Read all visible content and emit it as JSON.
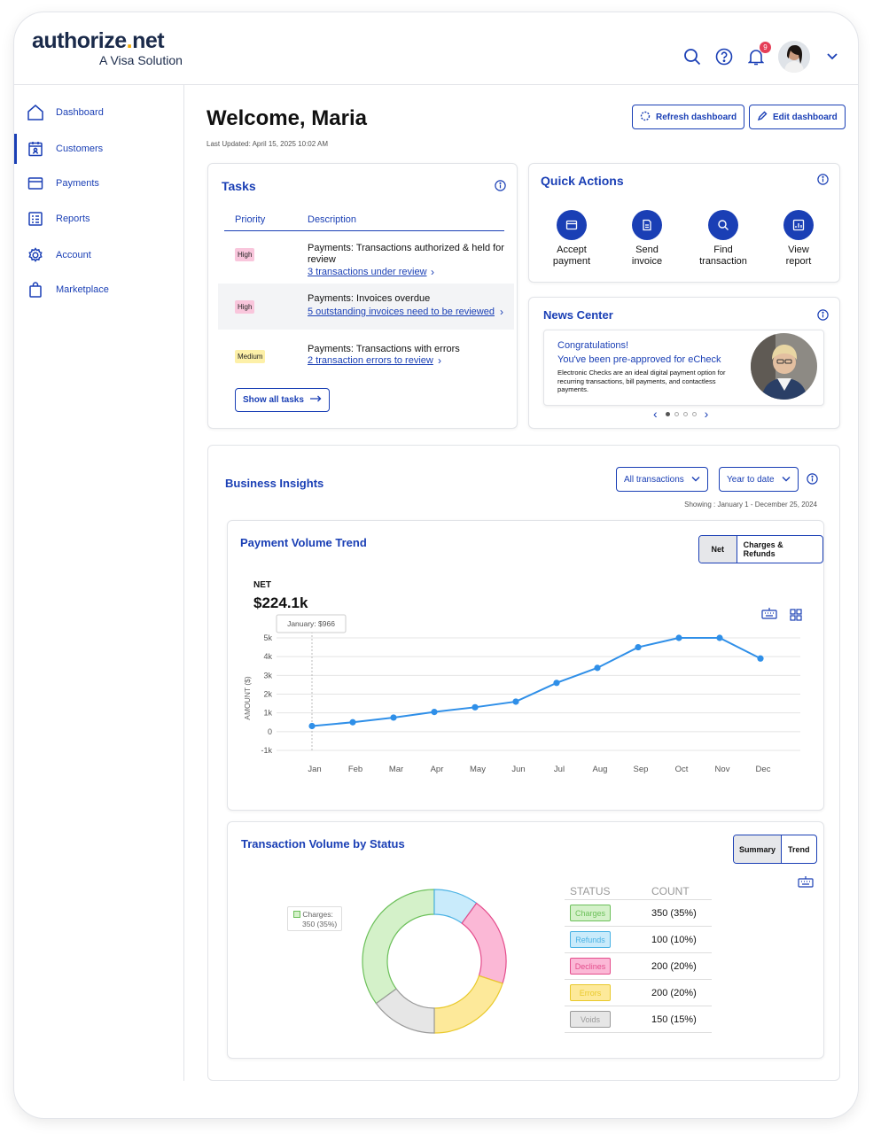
{
  "brand": {
    "name_part1": "authorize",
    "name_dot": ".",
    "name_part2": "net",
    "tagline": "A Visa Solution"
  },
  "header": {
    "notification_count": "9"
  },
  "sidebar": {
    "items": [
      {
        "label": "Dashboard",
        "icon": "home-icon"
      },
      {
        "label": "Customers",
        "icon": "calendar-user-icon",
        "active": true
      },
      {
        "label": "Payments",
        "icon": "card-icon"
      },
      {
        "label": "Reports",
        "icon": "report-icon"
      },
      {
        "label": "Account",
        "icon": "gear-icon"
      },
      {
        "label": "Marketplace",
        "icon": "bag-icon"
      }
    ]
  },
  "page": {
    "title": "Welcome, Maria",
    "last_updated": "Last Updated: April 15, 2025 10:02 AM",
    "refresh_label": "Refresh dashboard",
    "edit_label": "Edit dashboard"
  },
  "tasks": {
    "title": "Tasks",
    "col_priority": "Priority",
    "col_description": "Description",
    "rows": [
      {
        "priority": "High",
        "title": "Payments: Transactions authorized & held for review",
        "link": "3 transactions under review"
      },
      {
        "priority": "High",
        "title": "Payments: Invoices overdue",
        "link": "5 outstanding invoices need to be reviewed"
      },
      {
        "priority": "Medium",
        "title": "Payments: Transactions with errors",
        "link": "2 transaction errors to review"
      }
    ],
    "show_all": "Show all tasks"
  },
  "quick_actions": {
    "title": "Quick Actions",
    "items": [
      {
        "line1": "Accept",
        "line2": "payment",
        "icon": "payment-icon"
      },
      {
        "line1": "Send",
        "line2": "invoice",
        "icon": "invoice-icon"
      },
      {
        "line1": "Find",
        "line2": "transaction",
        "icon": "search-icon"
      },
      {
        "line1": "View",
        "line2": "report",
        "icon": "report-icon"
      }
    ]
  },
  "news": {
    "title": "News Center",
    "headline": "Congratulations!",
    "subheadline": "You've been pre-approved for eCheck",
    "body": "Electronic Checks are an ideal digital payment option for recurring transactions, bill payments, and contactless payments."
  },
  "insights": {
    "title": "Business Insights",
    "filter_type": "All transactions",
    "filter_period": "Year to date",
    "showing": "Showing : January 1 - December 25, 2024"
  },
  "payment_trend": {
    "title": "Payment Volume Trend",
    "seg_net": "Net",
    "seg_charges": "Charges & Refunds",
    "metric_label": "NET",
    "metric_value": "$224.1k",
    "tooltip": "January: $966",
    "chart_data": {
      "type": "line",
      "ylabel": "AMOUNT ($)",
      "categories": [
        "Jan",
        "Feb",
        "Mar",
        "Apr",
        "May",
        "Jun",
        "Jul",
        "Aug",
        "Sep",
        "Oct",
        "Nov",
        "Dec"
      ],
      "values": [
        300,
        500,
        750,
        1050,
        1300,
        1600,
        2600,
        3400,
        4500,
        5000,
        5000,
        3900
      ],
      "y_ticks": [
        "5k",
        "4k",
        "3k",
        "2k",
        "1k",
        "0",
        "-1k"
      ],
      "ylim": [
        -1000,
        5000
      ],
      "color": "#2f8fe8"
    }
  },
  "status_volume": {
    "title": "Transaction Volume by Status",
    "seg_summary": "Summary",
    "seg_trend": "Trend",
    "tooltip_label": "Charges:",
    "tooltip_value": "350 (35%)",
    "col_status": "STATUS",
    "col_count": "COUNT",
    "chart_data": {
      "type": "pie",
      "labels": [
        "Charges",
        "Refunds",
        "Declines",
        "Errors",
        "Voids"
      ],
      "counts": [
        350,
        100,
        200,
        200,
        150
      ],
      "display": [
        "350 (35%)",
        "100 (10%)",
        "200 (20%)",
        "200 (20%)",
        "150 (15%)"
      ],
      "fill": [
        "#d4f1c9",
        "#c9ebfb",
        "#fbb8d6",
        "#fde99a",
        "#e6e6e6"
      ],
      "stroke": [
        "#6cc05a",
        "#4ab2e4",
        "#e44d8c",
        "#e9c92b",
        "#9a9a9a"
      ]
    }
  }
}
